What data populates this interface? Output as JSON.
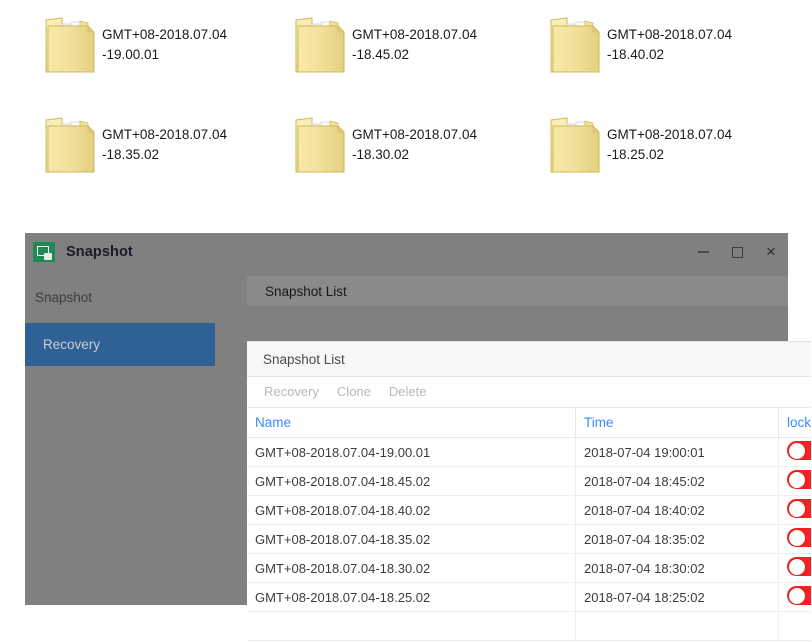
{
  "desktop": {
    "folders": [
      {
        "name": "GMT+08-2018.07.04-19.00.01",
        "line1": "GMT+08-2018.07.04",
        "line2": "-19.00.01",
        "icon": "folder-open-icon"
      },
      {
        "name": "GMT+08-2018.07.04-18.45.02",
        "line1": "GMT+08-2018.07.04",
        "line2": "-18.45.02",
        "icon": "folder-open-icon"
      },
      {
        "name": "GMT+08-2018.07.04-18.40.02",
        "line1": "GMT+08-2018.07.04",
        "line2": "-18.40.02",
        "icon": "folder-open-icon"
      },
      {
        "name": "GMT+08-2018.07.04-18.35.02",
        "line1": "GMT+08-2018.07.04",
        "line2": "-18.35.02",
        "icon": "folder-open-icon"
      },
      {
        "name": "GMT+08-2018.07.04-18.30.02",
        "line1": "GMT+08-2018.07.04",
        "line2": "-18.30.02",
        "icon": "folder-open-icon"
      },
      {
        "name": "GMT+08-2018.07.04-18.25.02",
        "line1": "GMT+08-2018.07.04",
        "line2": "-18.25.02",
        "icon": "folder-open-icon"
      }
    ]
  },
  "window": {
    "title": "Snapshot",
    "app_icon": "snapshot-app-icon",
    "controls": {
      "minimize": "–",
      "maximize": "□",
      "close": "×"
    },
    "colors": {
      "chrome": "#808080",
      "accent_selected": "#2f6096",
      "link": "#3d8bfd",
      "toggle_on": "#f32121",
      "app_icon_green": "#1f8a54"
    }
  },
  "sidebar": {
    "items": [
      {
        "label": "Snapshot",
        "selected": false
      },
      {
        "label": "Recovery",
        "selected": true
      }
    ]
  },
  "main": {
    "tabs": [
      {
        "label": "Snapshot List",
        "active": true
      }
    ],
    "panel_title": "Snapshot List",
    "toolbar": {
      "buttons": [
        {
          "label": "Recovery",
          "enabled": false
        },
        {
          "label": "Clone",
          "enabled": false
        },
        {
          "label": "Delete",
          "enabled": false
        }
      ]
    },
    "table": {
      "columns": [
        "Name",
        "Time",
        "locking"
      ],
      "rows": [
        {
          "name": "GMT+08-2018.07.04-19.00.01",
          "time": "2018-07-04 19:00:01",
          "locking": "on"
        },
        {
          "name": "GMT+08-2018.07.04-18.45.02",
          "time": "2018-07-04 18:45:02",
          "locking": "on"
        },
        {
          "name": "GMT+08-2018.07.04-18.40.02",
          "time": "2018-07-04 18:40:02",
          "locking": "on"
        },
        {
          "name": "GMT+08-2018.07.04-18.35.02",
          "time": "2018-07-04 18:35:02",
          "locking": "on"
        },
        {
          "name": "GMT+08-2018.07.04-18.30.02",
          "time": "2018-07-04 18:30:02",
          "locking": "on"
        },
        {
          "name": "GMT+08-2018.07.04-18.25.02",
          "time": "2018-07-04 18:25:02",
          "locking": "on"
        }
      ]
    }
  }
}
